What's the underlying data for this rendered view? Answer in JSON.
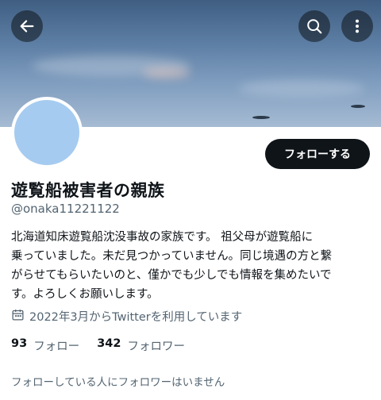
{
  "header": {
    "back_icon": "arrow-left-icon",
    "search_icon": "search-icon",
    "more_icon": "more-vertical-icon"
  },
  "profile": {
    "display_name": "遊覧船被害者の親族",
    "handle": "@onaka11221122",
    "bio_lines": [
      "北海道知床遊覧船沈没事故の家族です。 祖父母が遊覧船に",
      "乗っていました。未だ見つかっていません。同じ境遇の方と繋",
      "がらせてもらいたいのと、僅かでも少しでも情報を集めたいで",
      "す。よろしくお願いします。"
    ],
    "joined_text": "2022年3月からTwitterを利用しています",
    "follow_button_label": "フォローする",
    "following_count": "93",
    "following_label": "フォロー",
    "followers_count": "342",
    "followers_label": "フォロワー",
    "followed_by_text": "フォローしている人にフォロワーはいません"
  },
  "colors": {
    "avatar": "#a6cbf0",
    "primary_text": "#0f1419",
    "secondary_text": "#536471",
    "button_bg": "#0f1419"
  }
}
